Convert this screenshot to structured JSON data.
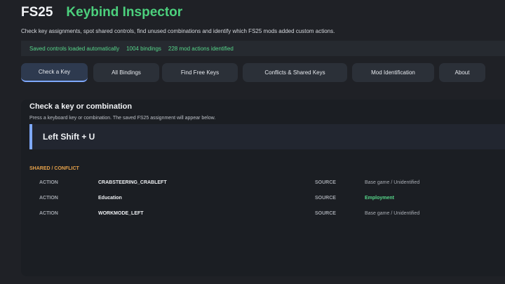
{
  "header": {
    "app_name": "FS25",
    "title": "Keybind Inspector",
    "subtitle": "Check key assignments, spot shared controls, find unused combinations and identify which FS25 mods added custom actions."
  },
  "status": {
    "saved": "Saved controls loaded automatically",
    "bindings": "1004 bindings",
    "mod_actions": "228 mod actions identified"
  },
  "tabs": [
    {
      "label": "Check a Key",
      "active": true
    },
    {
      "label": "All Bindings",
      "active": false
    },
    {
      "label": "Find Free Keys",
      "active": false
    },
    {
      "label": "Conflicts & Shared Keys",
      "active": false
    },
    {
      "label": "Mod Identification",
      "active": false
    },
    {
      "label": "About",
      "active": false
    }
  ],
  "panel": {
    "title": "Check a key or combination",
    "description": "Press a keyboard key or combination. The saved FS25 assignment will appear below.",
    "key": "Left Shift + U",
    "section_label": "SHARED / CONFLICT",
    "rows": [
      {
        "action_label": "ACTION",
        "action": "CRABSTEERING_CRABLEFT",
        "source_label": "SOURCE",
        "source": "Base game / Unidentified",
        "highlight": false
      },
      {
        "action_label": "ACTION",
        "action": "Education",
        "source_label": "SOURCE",
        "source": "Employment",
        "highlight": true
      },
      {
        "action_label": "ACTION",
        "action": "WORKMODE_LEFT",
        "source_label": "SOURCE",
        "source": "Base game / Unidentified",
        "highlight": false
      }
    ]
  },
  "colors": {
    "accent_green": "#4cd07d",
    "accent_blue": "#7fa9ff",
    "warning_orange": "#e6a24a",
    "background": "#1f2126"
  }
}
